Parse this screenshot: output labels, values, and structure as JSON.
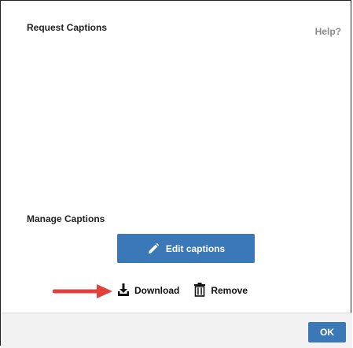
{
  "dialog": {
    "title": "Request Captions",
    "help_label": "Help?",
    "manage_label": "Manage Captions",
    "edit_button_label": "Edit captions",
    "download_label": "Download",
    "remove_label": "Remove",
    "ok_label": "OK"
  },
  "colors": {
    "primary_button": "#3a78b8",
    "annotation_arrow": "#e2403a",
    "footer_bg": "#f2f2f2"
  },
  "icons": {
    "edit": "pencil-icon",
    "download": "download-icon",
    "remove": "trash-icon",
    "annotation": "red-arrow"
  }
}
